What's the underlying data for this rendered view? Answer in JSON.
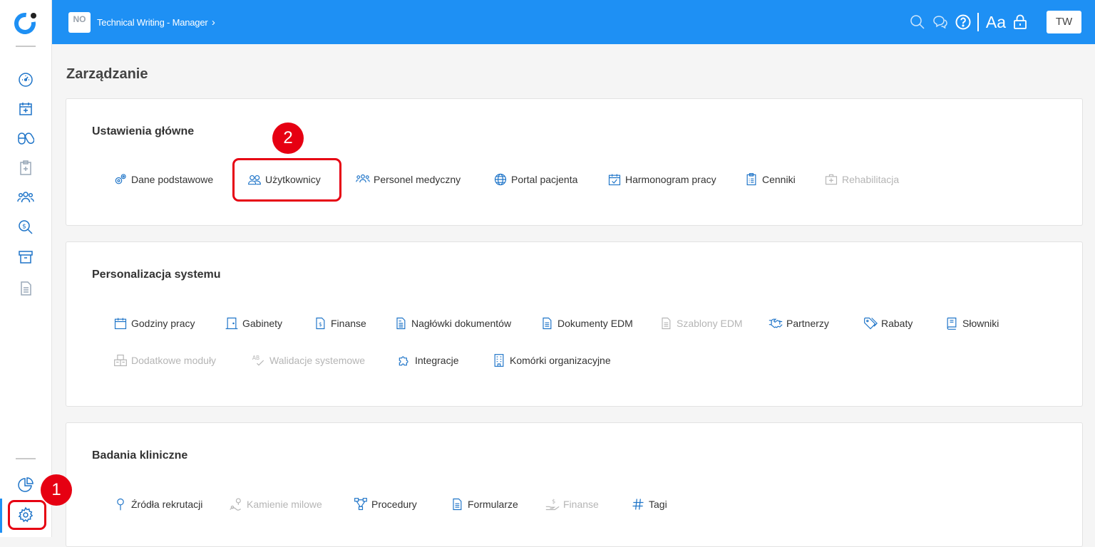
{
  "colors": {
    "brand": "#1e90f4",
    "highlight": "#e60012",
    "icon_blue": "#1e74c8",
    "disabled": "#b5b5b5"
  },
  "topbar": {
    "org_badge": "NO",
    "org_badge_sub": "",
    "breadcrumb": "Technical Writing - Manager",
    "chevron": "›",
    "aa_label": "Aa",
    "user_initials": "TW",
    "icons": [
      "search-icon",
      "chat-icon",
      "help-icon",
      "font-size-icon",
      "lock-icon"
    ]
  },
  "sidebar": {
    "items": [
      "dashboard-icon",
      "calendar-add-icon",
      "pills-icon",
      "medical-clipboard-icon",
      "users-icon",
      "search-dollar-icon",
      "archive-icon",
      "document-icon",
      "pie-chart-icon",
      "settings-icon"
    ],
    "active": "settings-icon"
  },
  "page": {
    "title": "Zarządzanie"
  },
  "sections": [
    {
      "title": "Ustawienia główne",
      "items": [
        {
          "label": "Dane podstawowe",
          "icon": "gears-icon",
          "enabled": true
        },
        {
          "label": "Użytkownicy",
          "icon": "users-icon",
          "enabled": true
        },
        {
          "label": "Personel medyczny",
          "icon": "group-icon",
          "enabled": true
        },
        {
          "label": "Portal pacjenta",
          "icon": "globe-icon",
          "enabled": true
        },
        {
          "label": "Harmonogram pracy",
          "icon": "calendar-check-icon",
          "enabled": true
        },
        {
          "label": "Cenniki",
          "icon": "price-list-icon",
          "enabled": true
        },
        {
          "label": "Rehabilitacja",
          "icon": "medical-case-icon",
          "enabled": false
        }
      ]
    },
    {
      "title": "Personalizacja systemu",
      "items": [
        {
          "label": "Godziny pracy",
          "icon": "calendar-icon",
          "enabled": true
        },
        {
          "label": "Gabinety",
          "icon": "door-icon",
          "enabled": true
        },
        {
          "label": "Finanse",
          "icon": "dollar-file-icon",
          "enabled": true
        },
        {
          "label": "Nagłówki dokumentów",
          "icon": "file-header-icon",
          "enabled": true
        },
        {
          "label": "Dokumenty EDM",
          "icon": "file-text-icon",
          "enabled": true
        },
        {
          "label": "Szablony EDM",
          "icon": "file-template-icon",
          "enabled": false
        },
        {
          "label": "Partnerzy",
          "icon": "handshake-icon",
          "enabled": true
        },
        {
          "label": "Rabaty",
          "icon": "tags-icon",
          "enabled": true
        },
        {
          "label": "Słowniki",
          "icon": "book-icon",
          "enabled": true
        },
        {
          "label": "Dodatkowe moduły",
          "icon": "modules-icon",
          "enabled": false
        },
        {
          "label": "Walidacje systemowe",
          "icon": "ab-check-icon",
          "enabled": false
        },
        {
          "label": "Integracje",
          "icon": "puzzle-icon",
          "enabled": true
        },
        {
          "label": "Komórki organizacyjne",
          "icon": "building-icon",
          "enabled": true
        }
      ]
    },
    {
      "title": "Badania kliniczne",
      "items": [
        {
          "label": "Źródła rekrutacji",
          "icon": "pin-icon",
          "enabled": true
        },
        {
          "label": "Kamienie milowe",
          "icon": "milestone-icon",
          "enabled": false
        },
        {
          "label": "Procedury",
          "icon": "flow-icon",
          "enabled": true
        },
        {
          "label": "Formularze",
          "icon": "form-icon",
          "enabled": true
        },
        {
          "label": "Finanse",
          "icon": "hand-dollar-icon",
          "enabled": false
        },
        {
          "label": "Tagi",
          "icon": "hash-icon",
          "enabled": true
        }
      ]
    }
  ],
  "annotations": [
    {
      "label": "1"
    },
    {
      "label": "2"
    }
  ]
}
